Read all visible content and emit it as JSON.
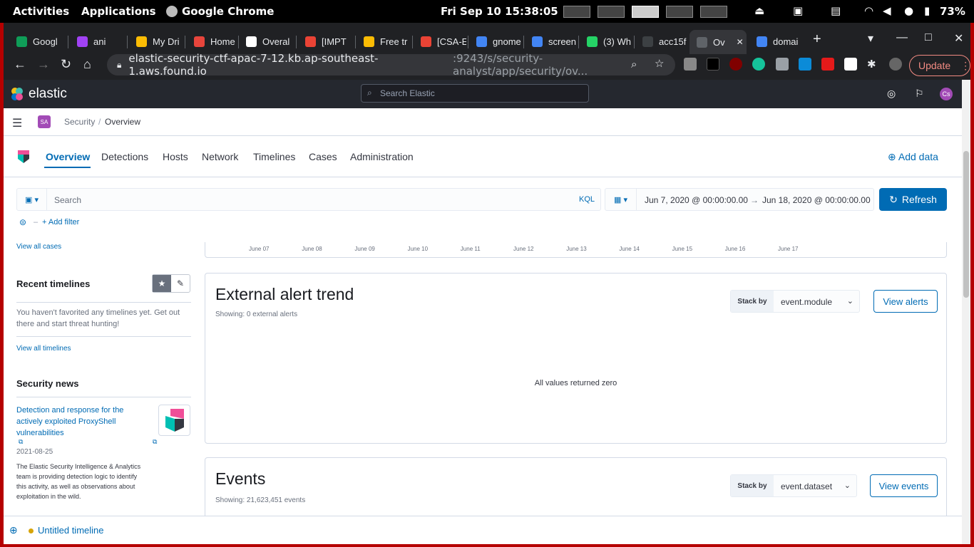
{
  "os_bar": {
    "activities": "Activities",
    "applications": "Applications",
    "app_name": "Google Chrome",
    "clock": "Fri Sep 10  15:38:05",
    "battery": "73%"
  },
  "browser": {
    "tabs": [
      {
        "label": "Googl",
        "color": "#0f9d58"
      },
      {
        "label": "ani",
        "color": "#a142f4"
      },
      {
        "label": "My Dri",
        "color": "#fbbc04"
      },
      {
        "label": "Home",
        "color": "#e8453c"
      },
      {
        "label": "Overal",
        "color": "#ffffff"
      },
      {
        "label": "[IMPT",
        "color": "#ea4335"
      },
      {
        "label": "Free tr",
        "color": "#fbbc04"
      },
      {
        "label": "[CSA-E",
        "color": "#ea4335"
      },
      {
        "label": "gnome",
        "color": "#4285f4"
      },
      {
        "label": "screen",
        "color": "#4285f4"
      },
      {
        "label": "(3) Wh",
        "color": "#25d366"
      },
      {
        "label": "acc15f",
        "color": "#3c4043"
      },
      {
        "label": "Ov",
        "color": "#5f6368"
      },
      {
        "label": "domai",
        "color": "#4285f4"
      }
    ],
    "url_host": "elastic-security-ctf-apac-7-12.kb.ap-southeast-1.aws.found.io",
    "url_path": ":9243/s/security-analyst/app/security/ov...",
    "update_label": "Update"
  },
  "kibana": {
    "brand": "elastic",
    "search_placeholder": "Search Elastic",
    "user_initials": "Cs"
  },
  "breadcrumb": {
    "space_badge": "SA",
    "root": "Security",
    "current": "Overview"
  },
  "nav": {
    "tabs": [
      "Overview",
      "Detections",
      "Hosts",
      "Network",
      "Timelines",
      "Cases",
      "Administration"
    ],
    "add_data": "Add data"
  },
  "query": {
    "placeholder": "Search",
    "kql": "KQL",
    "date_start": "Jun 7, 2020 @ 00:00:00.00",
    "date_end": "Jun 18, 2020 @ 00:00:00.00",
    "refresh": "Refresh",
    "add_filter": "+ Add filter"
  },
  "sidebar": {
    "view_all_cases": "View all cases",
    "recent_timelines_title": "Recent timelines",
    "recent_timelines_empty": "You haven't favorited any timelines yet. Get out there and start threat hunting!",
    "view_all_timelines": "View all timelines",
    "security_news_title": "Security news",
    "news_title": "Detection and response for the actively exploited ProxyShell vulnerabilities",
    "news_date": "2021-08-25",
    "news_body": "The Elastic Security Intelligence & Analytics team is providing detection logic to identify this activity, as well as observations about exploitation in the wild."
  },
  "chart_axis": {
    "ticks": [
      "June 07",
      "June 08",
      "June 09",
      "June 10",
      "June 11",
      "June 12",
      "June 13",
      "June 14",
      "June 15",
      "June 16",
      "June 17"
    ]
  },
  "external_alerts": {
    "title": "External alert trend",
    "showing": "Showing: 0 external alerts",
    "stack_by_label": "Stack by",
    "stack_by_value": "event.module",
    "button": "View alerts",
    "empty_message": "All values returned zero"
  },
  "events": {
    "title": "Events",
    "showing": "Showing: 21,623,451 events",
    "stack_by_label": "Stack by",
    "stack_by_value": "event.dataset",
    "button": "View events"
  },
  "timeline_bar": {
    "label": "Untitled timeline"
  }
}
